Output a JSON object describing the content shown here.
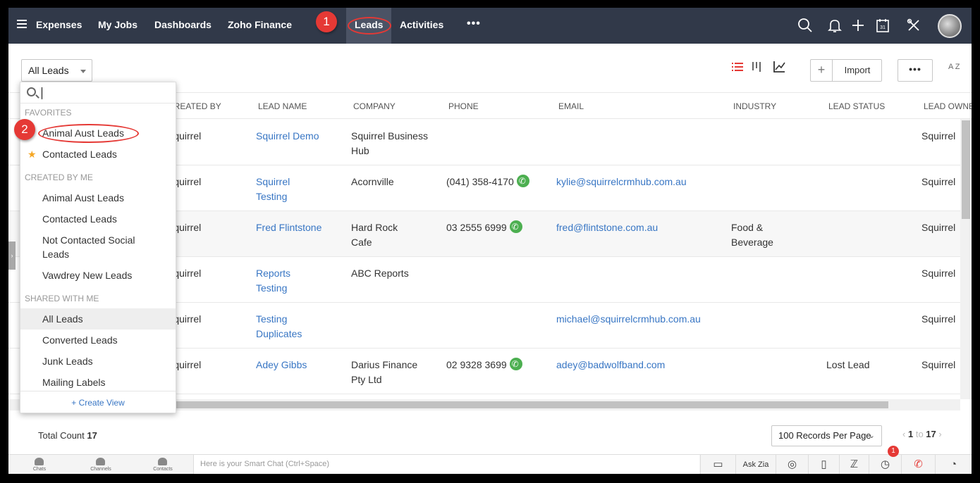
{
  "topbar": {
    "nav": [
      "Expenses",
      "My Jobs",
      "Dashboards",
      "Zoho Finance",
      "Leads",
      "Activities"
    ],
    "more": "•••",
    "annotation_1": "1",
    "annotation_2": "2"
  },
  "toolbar": {
    "view_selected": "All Leads",
    "import_label": "Import",
    "more_label": "•••",
    "sort_label": "A Z"
  },
  "table": {
    "headers": [
      "CREATED BY",
      "LEAD NAME",
      "COMPANY",
      "PHONE",
      "EMAIL",
      "INDUSTRY",
      "LEAD STATUS",
      "LEAD OWNER"
    ],
    "rows": [
      {
        "created_by": "Squirrel",
        "lead_name": "Squirrel Demo",
        "company": "Squirrel Business Hub",
        "phone": "",
        "email": "",
        "industry": "",
        "status": "",
        "owner": "Squirrel"
      },
      {
        "created_by": "Squirrel",
        "lead_name": "Squirrel Testing",
        "company": "Acornville",
        "phone": "(041) 358-4170",
        "email": "kylie@squirrelcrmhub.com.au",
        "industry": "",
        "status": "",
        "owner": "Squirrel"
      },
      {
        "created_by": "Squirrel",
        "lead_name": "Fred Flintstone",
        "company": "Hard Rock Cafe",
        "phone": "03 2555 6999",
        "email": "fred@flintstone.com.au",
        "industry": "Food & Beverage",
        "status": "",
        "owner": "Squirrel"
      },
      {
        "created_by": "Squirrel",
        "lead_name": "Reports Testing",
        "company": "ABC Reports",
        "phone": "",
        "email": "",
        "industry": "",
        "status": "",
        "owner": "Squirrel"
      },
      {
        "created_by": "Squirrel",
        "lead_name": "Testing Duplicates",
        "company": "",
        "phone": "",
        "email": "michael@squirrelcrmhub.com.au",
        "industry": "",
        "status": "",
        "owner": "Squirrel"
      },
      {
        "created_by": "Squirrel",
        "lead_name": "Adey Gibbs",
        "company": "Darius Finance Pty Ltd",
        "phone": "02 9328 3699",
        "email": "adey@badwolfband.com",
        "industry": "",
        "status": "Lost Lead",
        "owner": "Squirrel"
      }
    ]
  },
  "footer": {
    "total_label": "Total Count",
    "total_value": "17",
    "records_per_page": "100 Records Per Page",
    "page_from": "1",
    "page_to_label": "to",
    "page_to": "17"
  },
  "chatbar": {
    "tabs": [
      "Chats",
      "Channels",
      "Contacts"
    ],
    "placeholder": "Here is your Smart Chat (Ctrl+Space)",
    "ask_zia": "Ask Zia",
    "alarm_badge": "1"
  },
  "dropdown": {
    "sections": {
      "favorites": "FAVORITES",
      "created": "CREATED BY ME",
      "shared": "SHARED WITH ME"
    },
    "favorites": [
      "Animal Aust Leads",
      "Contacted Leads"
    ],
    "created": [
      "Animal Aust Leads",
      "Contacted Leads",
      "Not Contacted Social Leads",
      "Vawdrey New Leads"
    ],
    "shared": [
      "All Leads",
      "Converted Leads",
      "Junk Leads",
      "Mailing Labels"
    ],
    "create_view": "+ Create View"
  },
  "colors": {
    "topbar": "#313949",
    "link": "#3876c4",
    "annotation": "#e53935",
    "phone": "#4caf50"
  }
}
